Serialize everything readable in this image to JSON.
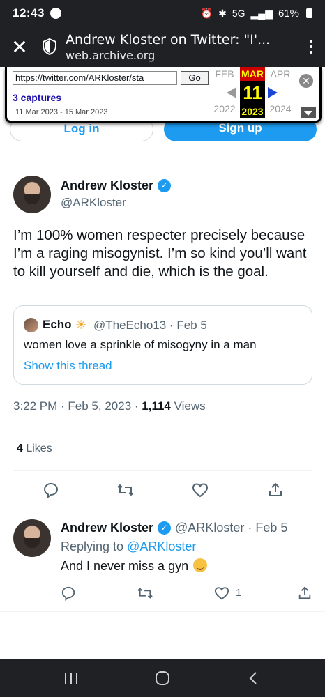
{
  "status_bar": {
    "time": "12:43",
    "network": "5G",
    "battery": "61%"
  },
  "browser": {
    "title": "Andrew Kloster on Twitter: \"I'...",
    "domain": "web.archive.org"
  },
  "wayback": {
    "url": "https://twitter.com/ARKloster/sta",
    "go_label": "Go",
    "captures": "3 captures",
    "range": "11 Mar 2023 - 15 Mar 2023",
    "prev_month": "FEB",
    "cur_month": "MAR",
    "next_month": "APR",
    "cur_day": "11",
    "prev_year": "2022",
    "cur_year": "2023",
    "next_year": "2024"
  },
  "auth": {
    "login": "Log in",
    "signup": "Sign up"
  },
  "tweet": {
    "author": "Andrew Kloster",
    "handle": "@ARKloster",
    "text": "I’m 100% women respecter precisely because I’m a raging misogynist.  I’m so kind you’ll want to kill yourself and die, which is the goal.",
    "quote": {
      "name": "Echo",
      "meta": "@TheEcho13 · Feb 5",
      "text": "women love a sprinkle of misogyny in a man",
      "link": "Show this thread"
    },
    "time": "3:22 PM · Feb 5, 2023 · ",
    "views_count": "1,114",
    "views_label": " Views",
    "likes_count": "4",
    "likes_label": " Likes"
  },
  "reply": {
    "author": "Andrew Kloster",
    "meta": "@ARKloster · Feb 5",
    "replying_prefix": "Replying to ",
    "replying_handle": "@ARKloster",
    "text": "And I never miss a gyn",
    "like_count": "1"
  }
}
